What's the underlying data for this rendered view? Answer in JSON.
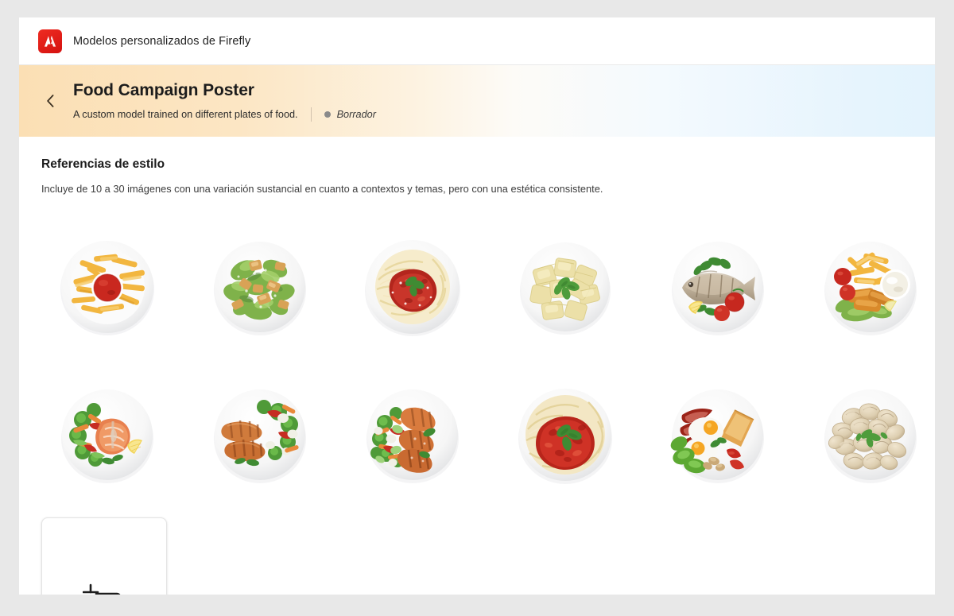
{
  "window": {
    "background_color": "#e8e8e8",
    "surface_color": "#ffffff"
  },
  "topbar": {
    "logo_icon": "adobe-logo-icon",
    "logo_color": "#e01b1b",
    "title": "Modelos personalizados de Firefly"
  },
  "banner": {
    "back_icon": "chevron-left-icon",
    "title": "Food Campaign Poster",
    "subtitle": "A custom model trained on different plates of food.",
    "status": {
      "dot_color": "#8a8a8a",
      "label": "Borrador"
    },
    "gradient_from": "#fbdfb4",
    "gradient_to": "#e3f3fd"
  },
  "main": {
    "section_title": "Referencias de estilo",
    "section_description": "Incluye de 10 a 30 imágenes con una variación sustancial en cuanto a contextos y temas, pero con una estética consistente.",
    "images": [
      {
        "name": "french-fries-with-ketchup",
        "alt": "Plato de patatas fritas con kétchup"
      },
      {
        "name": "caesar-salad-with-chicken",
        "alt": "Ensalada César con pollo"
      },
      {
        "name": "spaghetti-bolognese",
        "alt": "Espaguetis a la boloñesa"
      },
      {
        "name": "ravioli-with-basil",
        "alt": "Raviolis con albahaca"
      },
      {
        "name": "grilled-whole-fish",
        "alt": "Pescado a la parrilla con tomate y limón"
      },
      {
        "name": "fish-sticks-with-fries",
        "alt": "Palitos de pescado con patatas fritas y salsa"
      },
      {
        "name": "salmon-steak-with-vegetables",
        "alt": "Filete de salmón con verduras y limón"
      },
      {
        "name": "grilled-chicken-with-vegetables",
        "alt": "Pollo a la parrilla con verduras"
      },
      {
        "name": "grilled-salmon-with-salad",
        "alt": "Salmón a la parrilla con ensalada de verduras"
      },
      {
        "name": "pasta-with-tomato-sauce",
        "alt": "Pasta con salsa de tomate y albahaca"
      },
      {
        "name": "english-breakfast",
        "alt": "Desayuno inglés con huevos, bacon y tostada"
      },
      {
        "name": "tortellini-dumplings",
        "alt": "Plato de tortellini"
      }
    ],
    "upload_card": {
      "icon": "add-image-icon"
    }
  }
}
